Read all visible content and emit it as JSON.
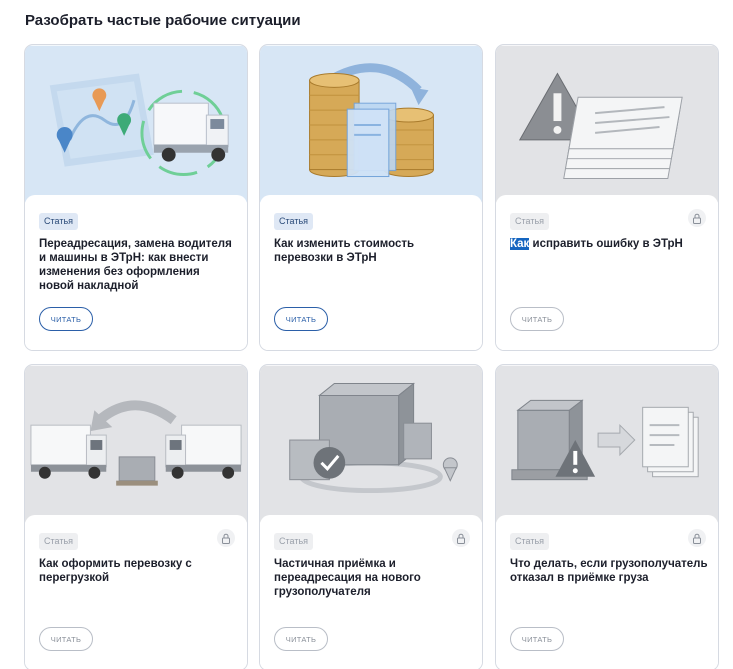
{
  "section": {
    "title": "Разобрать частые рабочие ситуации"
  },
  "cards": [
    {
      "badge": "Статья",
      "title_rest": "Переадресация, замена водителя и машины в ЭТрН: как внести изменения без оформления новой накладной",
      "button": "ЧИТАТЬ",
      "locked": false,
      "illustration": "route-truck-illustration"
    },
    {
      "badge": "Статья",
      "title_rest": "Как изменить стоимость перевозки в ЭТрН",
      "button": "ЧИТАТЬ",
      "locked": false,
      "illustration": "coins-documents-illustration"
    },
    {
      "badge": "Статья",
      "title_highlight": "Как",
      "title_rest": " исправить ошибку в ЭТрН",
      "button": "ЧИТАТЬ",
      "locked": true,
      "illustration": "warning-documents-illustration"
    },
    {
      "badge": "Статья",
      "title_rest": "Как оформить перевозку с перегрузкой",
      "button": "ЧИТАТЬ",
      "locked": true,
      "illustration": "two-trucks-illustration"
    },
    {
      "badge": "Статья",
      "title_rest": "Частичная приёмка и переадресация на нового грузополучателя",
      "button": "ЧИТАТЬ",
      "locked": true,
      "illustration": "boxes-check-illustration"
    },
    {
      "badge": "Статья",
      "title_rest": "Что делать, если грузополучатель отказал в приёмке груза",
      "button": "ЧИТАТЬ",
      "locked": true,
      "illustration": "pallet-warning-illustration"
    }
  ],
  "colors": {
    "accent": "#2b5fa8",
    "highlight": "#1565c0",
    "free_bg": "#d7e6f5",
    "locked_bg": "#e2e3e6"
  }
}
